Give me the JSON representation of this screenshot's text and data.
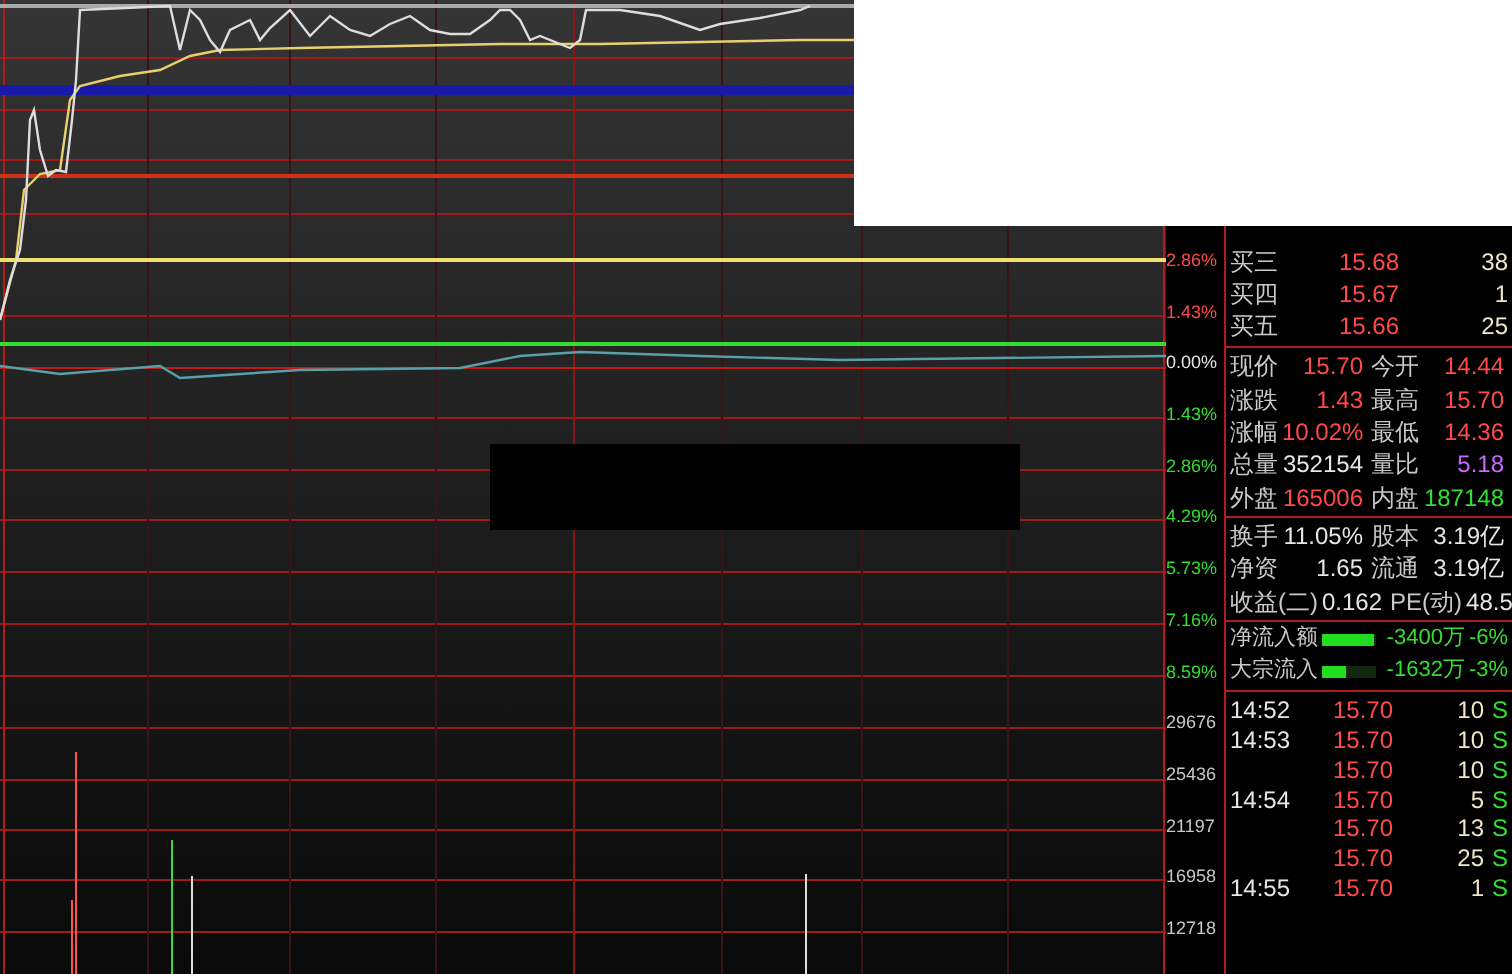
{
  "axis_labels": [
    {
      "text": "2.86%",
      "color": "#ff4a4a"
    },
    {
      "text": "1.43%",
      "color": "#ff4a4a"
    },
    {
      "text": "0.00%",
      "color": "#e6e6e6"
    },
    {
      "text": "1.43%",
      "color": "#33dd33"
    },
    {
      "text": "2.86%",
      "color": "#33dd33"
    },
    {
      "text": "4.29%",
      "color": "#33dd33"
    },
    {
      "text": "5.73%",
      "color": "#33dd33"
    },
    {
      "text": "7.16%",
      "color": "#33dd33"
    },
    {
      "text": "8.59%",
      "color": "#33dd33"
    },
    {
      "text": "29676",
      "color": "#c8c8c8"
    },
    {
      "text": "25436",
      "color": "#c8c8c8"
    },
    {
      "text": "21197",
      "color": "#c8c8c8"
    },
    {
      "text": "16958",
      "color": "#c8c8c8"
    },
    {
      "text": "12718",
      "color": "#c8c8c8"
    }
  ],
  "order_book": [
    {
      "label": "买三",
      "price": "15.68",
      "volume": "38"
    },
    {
      "label": "买四",
      "price": "15.67",
      "volume": "1"
    },
    {
      "label": "买五",
      "price": "15.66",
      "volume": "25"
    }
  ],
  "quote": [
    [
      {
        "label": "现价",
        "value": "15.70",
        "color": "#ff4a4a"
      },
      {
        "label": "今开",
        "value": "14.44",
        "color": "#ff4a4a"
      }
    ],
    [
      {
        "label": "涨跌",
        "value": "1.43",
        "color": "#ff4a4a"
      },
      {
        "label": "最高",
        "value": "15.70",
        "color": "#ff4a4a"
      }
    ],
    [
      {
        "label": "涨幅",
        "value": "10.02%",
        "color": "#ff4a4a"
      },
      {
        "label": "最低",
        "value": "14.36",
        "color": "#ff4a4a"
      }
    ],
    [
      {
        "label": "总量",
        "value": "352154",
        "color": "#e6e6e6"
      },
      {
        "label": "量比",
        "value": "5.18",
        "color": "#cc66ff"
      }
    ],
    [
      {
        "label": "外盘",
        "value": "165006",
        "color": "#ff4a4a"
      },
      {
        "label": "内盘",
        "value": "187148",
        "color": "#33dd33"
      }
    ]
  ],
  "fundamentals": [
    [
      {
        "label": "换手",
        "value": "11.05%"
      },
      {
        "label": "股本",
        "value": "3.19亿"
      }
    ],
    [
      {
        "label": "净资",
        "value": "1.65"
      },
      {
        "label": "流通",
        "value": "3.19亿"
      }
    ],
    [
      {
        "label": "收益(二)",
        "value": "0.162"
      },
      {
        "label": "PE(动)",
        "value": "48.5"
      }
    ]
  ],
  "flows": [
    {
      "label": "净流入额",
      "level": 0.95,
      "amount": "-3400万",
      "percent": "-6%"
    },
    {
      "label": "大宗流入",
      "level": 0.45,
      "amount": "-1632万",
      "percent": "-3%"
    }
  ],
  "ticks": [
    {
      "time": "14:52",
      "price": "15.70",
      "volume": "10",
      "side": "S"
    },
    {
      "time": "14:53",
      "price": "15.70",
      "volume": "10",
      "side": "S"
    },
    {
      "price": "15.70",
      "volume": "10",
      "side": "S"
    },
    {
      "time": "14:54",
      "price": "15.70",
      "volume": "5",
      "side": "S"
    },
    {
      "price": "15.70",
      "volume": "13",
      "side": "S"
    },
    {
      "price": "15.70",
      "volume": "25",
      "side": "S"
    },
    {
      "time": "14:55",
      "price": "15.70",
      "volume": "1",
      "side": "S"
    }
  ]
}
